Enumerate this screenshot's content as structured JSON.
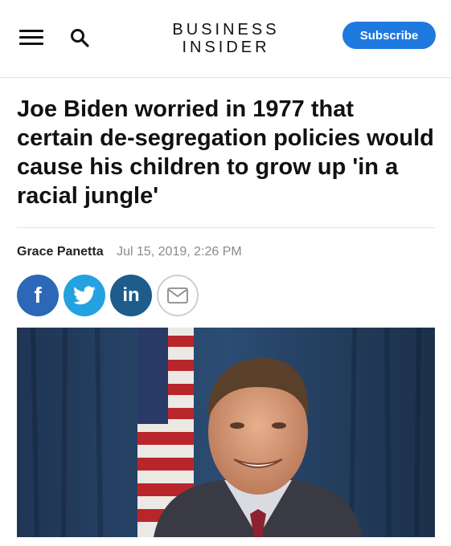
{
  "header": {
    "logo_line1": "BUSINESS",
    "logo_line2": "INSIDER",
    "subscribe_label": "Subscribe"
  },
  "article": {
    "headline": "Joe Biden worried in 1977 that certain de-segregation policies would cause his children to grow up 'in a racial jungle'",
    "author": "Grace Panetta",
    "date": "Jul 15, 2019, 2:26 PM"
  },
  "share": {
    "facebook_glyph": "f",
    "linkedin_glyph": "in"
  },
  "colors": {
    "subscribe": "#1f7ae0",
    "facebook": "#2c67b8",
    "twitter": "#24a2df",
    "linkedin": "#1d5c8b"
  },
  "icons": [
    "menu-icon",
    "search-icon",
    "facebook-icon",
    "twitter-icon",
    "linkedin-icon",
    "email-icon"
  ]
}
